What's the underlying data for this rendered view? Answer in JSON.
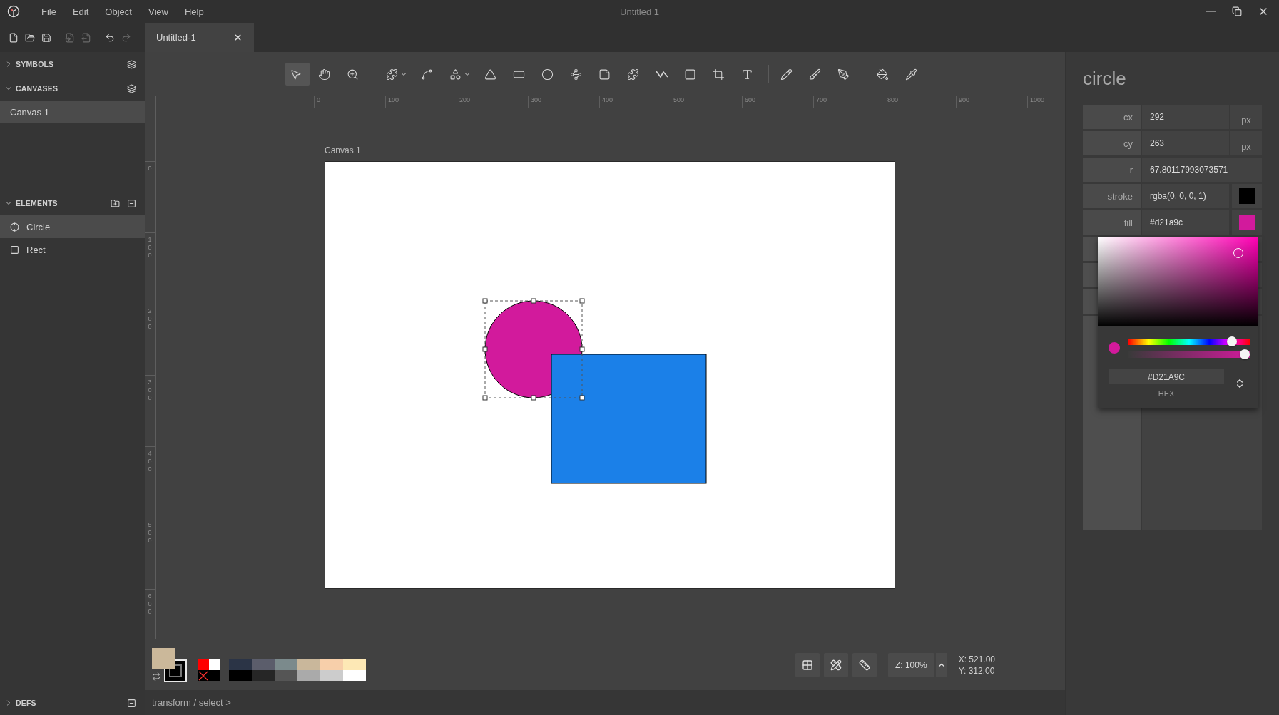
{
  "window": {
    "title": "Untitled 1",
    "menu": [
      "File",
      "Edit",
      "Object",
      "View",
      "Help"
    ]
  },
  "file_actions": [
    {
      "kind": "new",
      "disabled": false
    },
    {
      "kind": "open",
      "disabled": false
    },
    {
      "kind": "save",
      "disabled": false
    },
    {
      "kind": "import",
      "disabled": true
    },
    {
      "kind": "export",
      "disabled": true
    },
    {
      "kind": "undo",
      "disabled": false
    },
    {
      "kind": "redo",
      "disabled": true
    }
  ],
  "tabs": [
    {
      "label": "Untitled-1",
      "selected": true
    }
  ],
  "sidebar": {
    "sections": [
      {
        "title": "SYMBOLS",
        "expanded": false
      },
      {
        "title": "CANVASES",
        "expanded": true,
        "items": [
          {
            "label": "Canvas 1",
            "kind": "canvas",
            "selected": true
          }
        ]
      },
      {
        "title": "ELEMENTS",
        "expanded": true,
        "items": [
          {
            "label": "Circle",
            "kind": "circle",
            "selected": true
          },
          {
            "label": "Rect",
            "kind": "rect",
            "selected": false
          }
        ]
      },
      {
        "title": "DEFS",
        "expanded": false
      }
    ]
  },
  "tool_groups": [
    {
      "tools": [
        {
          "kind": "pointer",
          "selected": true,
          "dropdown": false
        },
        {
          "kind": "hand",
          "selected": false,
          "dropdown": false
        },
        {
          "kind": "zoom",
          "selected": false,
          "dropdown": false
        }
      ]
    },
    {
      "tools": [
        {
          "kind": "component",
          "selected": false,
          "dropdown": true
        },
        {
          "kind": "bezier",
          "selected": false,
          "dropdown": false
        },
        {
          "kind": "shapes",
          "selected": false,
          "dropdown": true
        },
        {
          "kind": "triangle",
          "selected": false,
          "dropdown": false
        },
        {
          "kind": "rectangle",
          "selected": false,
          "dropdown": false
        },
        {
          "kind": "ellipse",
          "selected": false,
          "dropdown": false
        },
        {
          "kind": "path",
          "selected": false,
          "dropdown": false
        },
        {
          "kind": "note",
          "selected": false,
          "dropdown": false
        },
        {
          "kind": "symbol",
          "selected": false,
          "dropdown": false
        },
        {
          "kind": "polyline",
          "selected": false,
          "dropdown": false
        },
        {
          "kind": "frame",
          "selected": false,
          "dropdown": false
        },
        {
          "kind": "skew",
          "selected": false,
          "dropdown": false
        },
        {
          "kind": "text",
          "selected": false,
          "dropdown": false
        }
      ]
    },
    {
      "tools": [
        {
          "kind": "pencil",
          "selected": false,
          "dropdown": false
        },
        {
          "kind": "brush",
          "selected": false,
          "dropdown": false
        },
        {
          "kind": "pen",
          "selected": false,
          "dropdown": false
        }
      ]
    },
    {
      "tools": [
        {
          "kind": "fill",
          "selected": false,
          "dropdown": false
        },
        {
          "kind": "picker",
          "selected": false,
          "dropdown": false
        }
      ]
    }
  ],
  "rulers": {
    "horizontal": [
      "0",
      "100",
      "200",
      "300",
      "400",
      "500",
      "600",
      "700",
      "800",
      "900",
      "1000"
    ],
    "vertical": [
      "0",
      "100",
      "200",
      "300",
      "400",
      "500",
      "600"
    ]
  },
  "canvas": {
    "label": "Canvas 1",
    "shapes": [
      {
        "kind": "circle",
        "color": "#d21a9c",
        "selected": true
      },
      {
        "kind": "rect",
        "color": "#1b80e8",
        "selected": false
      }
    ]
  },
  "palette": {
    "current": [
      {
        "kind": "fill",
        "color": "#cbb89a"
      },
      {
        "kind": "stroke",
        "color": "#000000"
      }
    ],
    "presets": [
      {
        "kind": "color",
        "color": "#ff0000"
      },
      {
        "kind": "color",
        "color": "#ffffff"
      },
      {
        "kind": "none"
      },
      {
        "kind": "color",
        "color": "#000000"
      }
    ],
    "swatches": [
      {
        "color": "#2b3446"
      },
      {
        "color": "#5b5d6b"
      },
      {
        "color": "#7b8a8c"
      },
      {
        "color": "#c9b79b"
      },
      {
        "color": "#f7cfaa"
      },
      {
        "color": "#fde8b5"
      },
      {
        "color": "#000000"
      },
      {
        "color": "#262626"
      },
      {
        "color": "#555555"
      },
      {
        "color": "#aaaaaa"
      },
      {
        "color": "#cccccc"
      },
      {
        "color": "#ffffff"
      }
    ]
  },
  "view_controls": {
    "zoom": "Z: 100%",
    "x": "X: 521.00",
    "y": "Y: 312.00"
  },
  "status_bar": "transform / select >",
  "inspector": {
    "title": "circle",
    "properties": [
      {
        "label": "cx",
        "value": "292",
        "unit": "px"
      },
      {
        "label": "cy",
        "value": "263",
        "unit": "px"
      },
      {
        "label": "r",
        "value": "67.80117993073571"
      },
      {
        "label": "stroke",
        "value": "rgba(0, 0, 0, 1)",
        "color": "#000000"
      },
      {
        "label": "fill",
        "value": "#d21a9c",
        "color": "#d21a9c"
      }
    ],
    "color_picker": {
      "hex": "#D21A9C",
      "format": "HEX",
      "opacity": {
        "level": 1
      }
    }
  }
}
